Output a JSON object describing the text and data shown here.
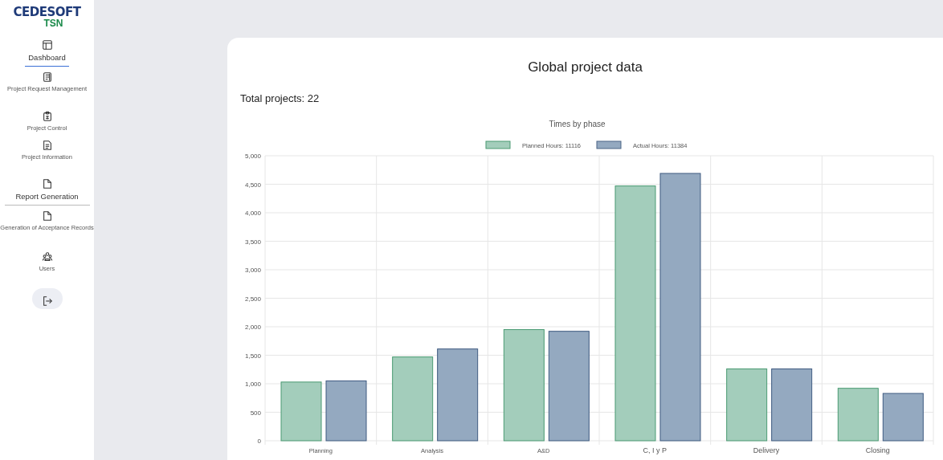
{
  "logo": {
    "brand": "CEDESOFT",
    "sub": "TSN"
  },
  "sidebar": {
    "items": [
      {
        "label": "Dashboard",
        "selected": true,
        "divider": false
      },
      {
        "label": "Project Request Management",
        "selected": false,
        "divider": false
      },
      {
        "label": "Project Control",
        "selected": false,
        "divider": false
      },
      {
        "label": "Project Information",
        "selected": false,
        "divider": false
      },
      {
        "label": "Report Generation",
        "selected": false,
        "divider": true
      },
      {
        "label": "Generation of Acceptance Records",
        "selected": false,
        "divider": false
      },
      {
        "label": "Users",
        "selected": false,
        "divider": false
      }
    ]
  },
  "main": {
    "title": "Global project data",
    "total": "Total projects: 22",
    "chart_data": {
      "type": "bar",
      "title": "Times by phase",
      "legend": true,
      "grid": true,
      "categories": [
        "Planning",
        "Analysis",
        "A&D",
        "C, I y P",
        "Delivery",
        "Closing"
      ],
      "series": [
        {
          "name": "Planned Hours: 11116",
          "color": "#a3cdbb",
          "values": [
            1030,
            1470,
            1950,
            4470,
            1260,
            920
          ]
        },
        {
          "name": "Actual Hours: 11384",
          "color": "#94a9c0",
          "values": [
            1050,
            1610,
            1920,
            4690,
            1260,
            830
          ]
        }
      ],
      "ylim": [
        0,
        5000
      ],
      "yticks": [
        0,
        {
          "value": 500,
          "label": "500"
        },
        {
          "value": 1000,
          "label": "1,000"
        },
        {
          "value": 1500,
          "label": "1,500"
        },
        {
          "value": 2000,
          "label": "2,000"
        },
        {
          "value": 2500,
          "label": "2,500"
        },
        {
          "value": 3000,
          "label": "3,000"
        },
        {
          "value": 3500,
          "label": "3,500"
        },
        {
          "value": 4000,
          "label": "4,000"
        },
        {
          "value": 4500,
          "label": "4,500"
        },
        {
          "value": 5000,
          "label": "5,000"
        }
      ]
    }
  }
}
